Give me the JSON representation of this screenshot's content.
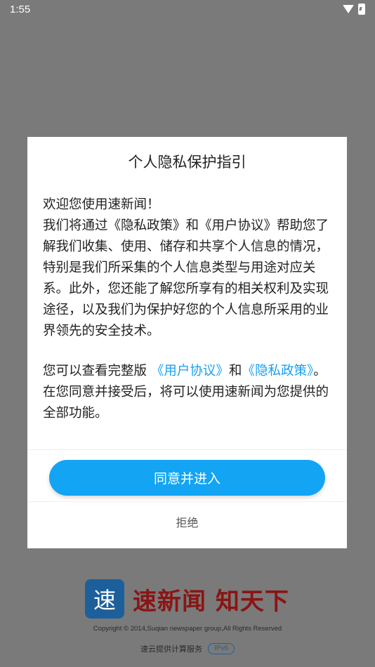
{
  "status_bar": {
    "time": "1:55"
  },
  "dialog": {
    "title": "个人隐私保护指引",
    "greeting": "欢迎您使用速新闻！",
    "para1": "我们将通过《隐私政策》和《用户协议》帮助您了解我们收集、使用、储存和共享个人信息的情况，特别是我们所采集的个人信息类型与用途对应关系。此外，您还能了解您所享有的相关权利及实现途径，以及我们为保护好您的个人信息所采用的业界领先的安全技术。",
    "para2_prefix": "您可以查看完整版",
    "user_agreement_link": "《用户协议》",
    "and": "和",
    "privacy_policy_link": "《隐私政策》",
    "para2_suffix": "。在您同意并接受后，将可以使用速新闻为您提供的全部功能。",
    "agree_button": "同意并进入",
    "reject_button": "拒绝"
  },
  "footer": {
    "logo_char": "速",
    "slogan": "速新闻 知天下",
    "copyright": "Copyright © 2014,Suqian newspaper group,All Rights Reserved",
    "service_text": "速云提供计算服务",
    "ipv6_badge": "IPv6"
  }
}
